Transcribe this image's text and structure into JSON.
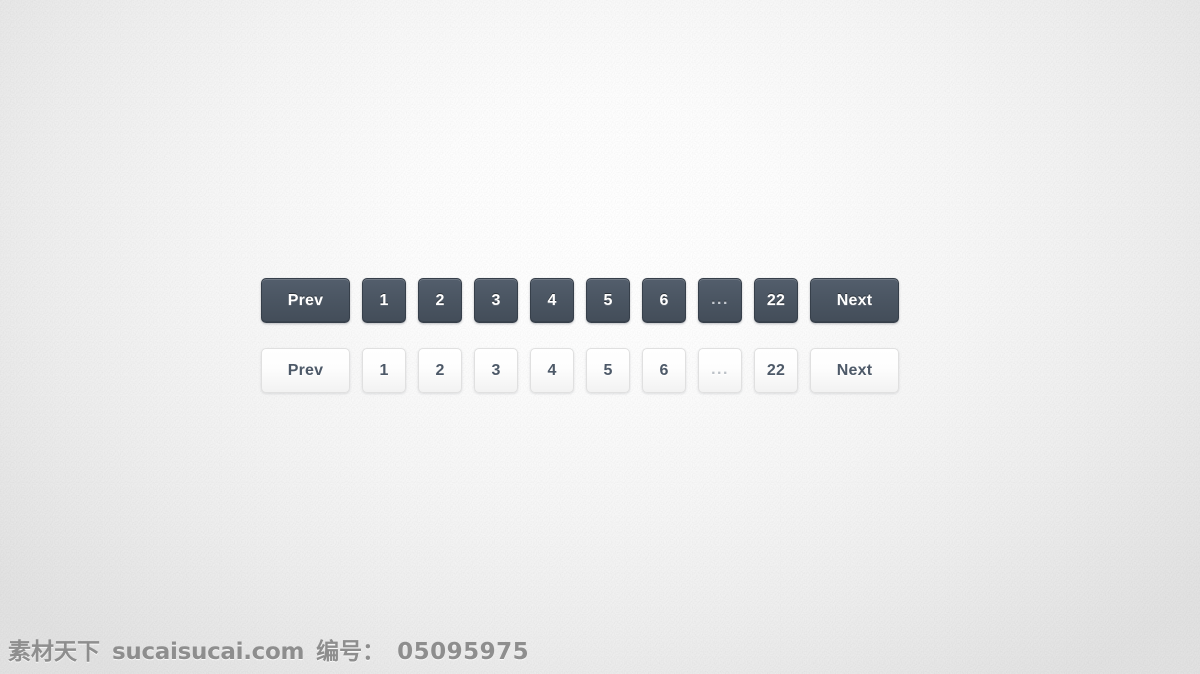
{
  "page": {
    "background_center": "#ffffff",
    "background_edge": "#e2e2e2"
  },
  "pagination_dark": {
    "style_name": "dark",
    "accent": "#4c5764",
    "text_color": "#ffffff",
    "buttons": [
      {
        "label": "Prev",
        "name": "prev",
        "wide": true
      },
      {
        "label": "1",
        "name": "page-1"
      },
      {
        "label": "2",
        "name": "page-2"
      },
      {
        "label": "3",
        "name": "page-3"
      },
      {
        "label": "4",
        "name": "page-4"
      },
      {
        "label": "5",
        "name": "page-5"
      },
      {
        "label": "6",
        "name": "page-6"
      },
      {
        "label": "...",
        "name": "ellipsis"
      },
      {
        "label": "22",
        "name": "page-22"
      },
      {
        "label": "Next",
        "name": "next",
        "wide": true
      }
    ]
  },
  "pagination_light": {
    "style_name": "light",
    "accent": "#fdfdfd",
    "text_color": "#4d5968",
    "buttons": [
      {
        "label": "Prev",
        "name": "prev",
        "wide": true
      },
      {
        "label": "1",
        "name": "page-1"
      },
      {
        "label": "2",
        "name": "page-2"
      },
      {
        "label": "3",
        "name": "page-3"
      },
      {
        "label": "4",
        "name": "page-4"
      },
      {
        "label": "5",
        "name": "page-5"
      },
      {
        "label": "6",
        "name": "page-6"
      },
      {
        "label": "...",
        "name": "ellipsis"
      },
      {
        "label": "22",
        "name": "page-22"
      },
      {
        "label": "Next",
        "name": "next",
        "wide": true
      }
    ]
  },
  "watermark": {
    "brand": "素材天下",
    "site": "sucaisucai.com",
    "id_label": "编号：",
    "id_value": "05095975"
  }
}
